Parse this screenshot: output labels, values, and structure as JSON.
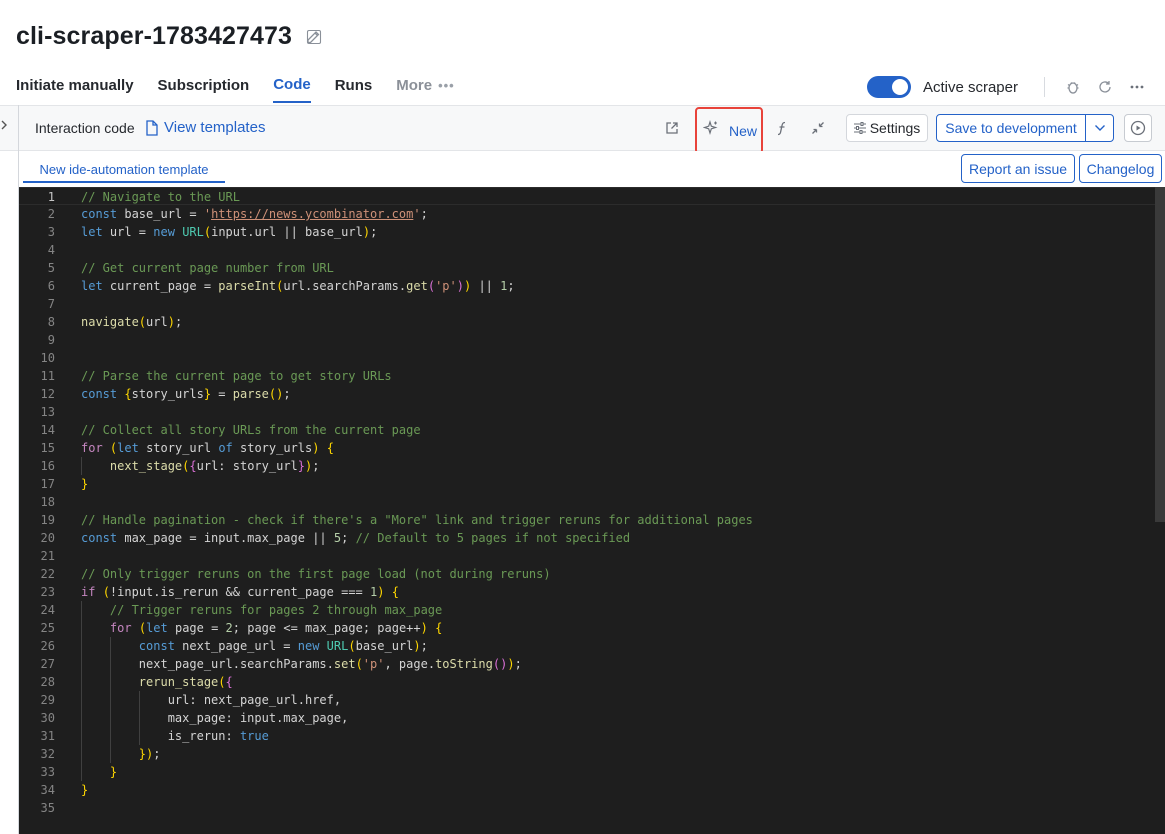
{
  "page": {
    "title": "cli-scraper-1783427473"
  },
  "tabs": [
    {
      "label": "Initiate manually"
    },
    {
      "label": "Subscription"
    },
    {
      "label": "Code"
    },
    {
      "label": "Runs"
    },
    {
      "label": "More"
    }
  ],
  "header": {
    "active_scraper_label": "Active scraper",
    "active_scraper_on": true,
    "icons": [
      "bug-icon",
      "refresh-icon",
      "more-icon"
    ]
  },
  "toolbar": {
    "interaction_label": "Interaction code",
    "view_templates_label": "View templates",
    "new_label": "New",
    "settings_label": "Settings",
    "save_label": "Save to development"
  },
  "editor_tabs": {
    "file_tab_label": "New ide-automation template",
    "report_label": "Report an issue",
    "changelog_label": "Changelog"
  },
  "editor": {
    "current_line": 1,
    "lines": [
      "// Navigate to the URL",
      "const base_url = 'https://news.ycombinator.com';",
      "let url = new URL(input.url || base_url);",
      "",
      "// Get current page number from URL",
      "let current_page = parseInt(url.searchParams.get('p')) || 1;",
      "",
      "navigate(url);",
      "",
      "",
      "// Parse the current page to get story URLs",
      "const {story_urls} = parse();",
      "",
      "// Collect all story URLs from the current page",
      "for (let story_url of story_urls) {",
      "    next_stage({url: story_url});",
      "}",
      "",
      "// Handle pagination - check if there's a \"More\" link and trigger reruns for additional pages",
      "const max_page = input.max_page || 5; // Default to 5 pages if not specified",
      "",
      "// Only trigger reruns on the first page load (not during reruns)",
      "if (!input.is_rerun && current_page === 1) {",
      "    // Trigger reruns for pages 2 through max_page",
      "    for (let page = 2; page <= max_page; page++) {",
      "        const next_page_url = new URL(base_url);",
      "        next_page_url.searchParams.set('p', page.toString());",
      "        rerun_stage({",
      "            url: next_page_url.href,",
      "            max_page: input.max_page,",
      "            is_rerun: true",
      "        });",
      "    }",
      "}",
      ""
    ]
  },
  "colors": {
    "accent": "#2462c8",
    "highlight_border": "#e8433a",
    "editor_bg": "#1e1e1e"
  }
}
